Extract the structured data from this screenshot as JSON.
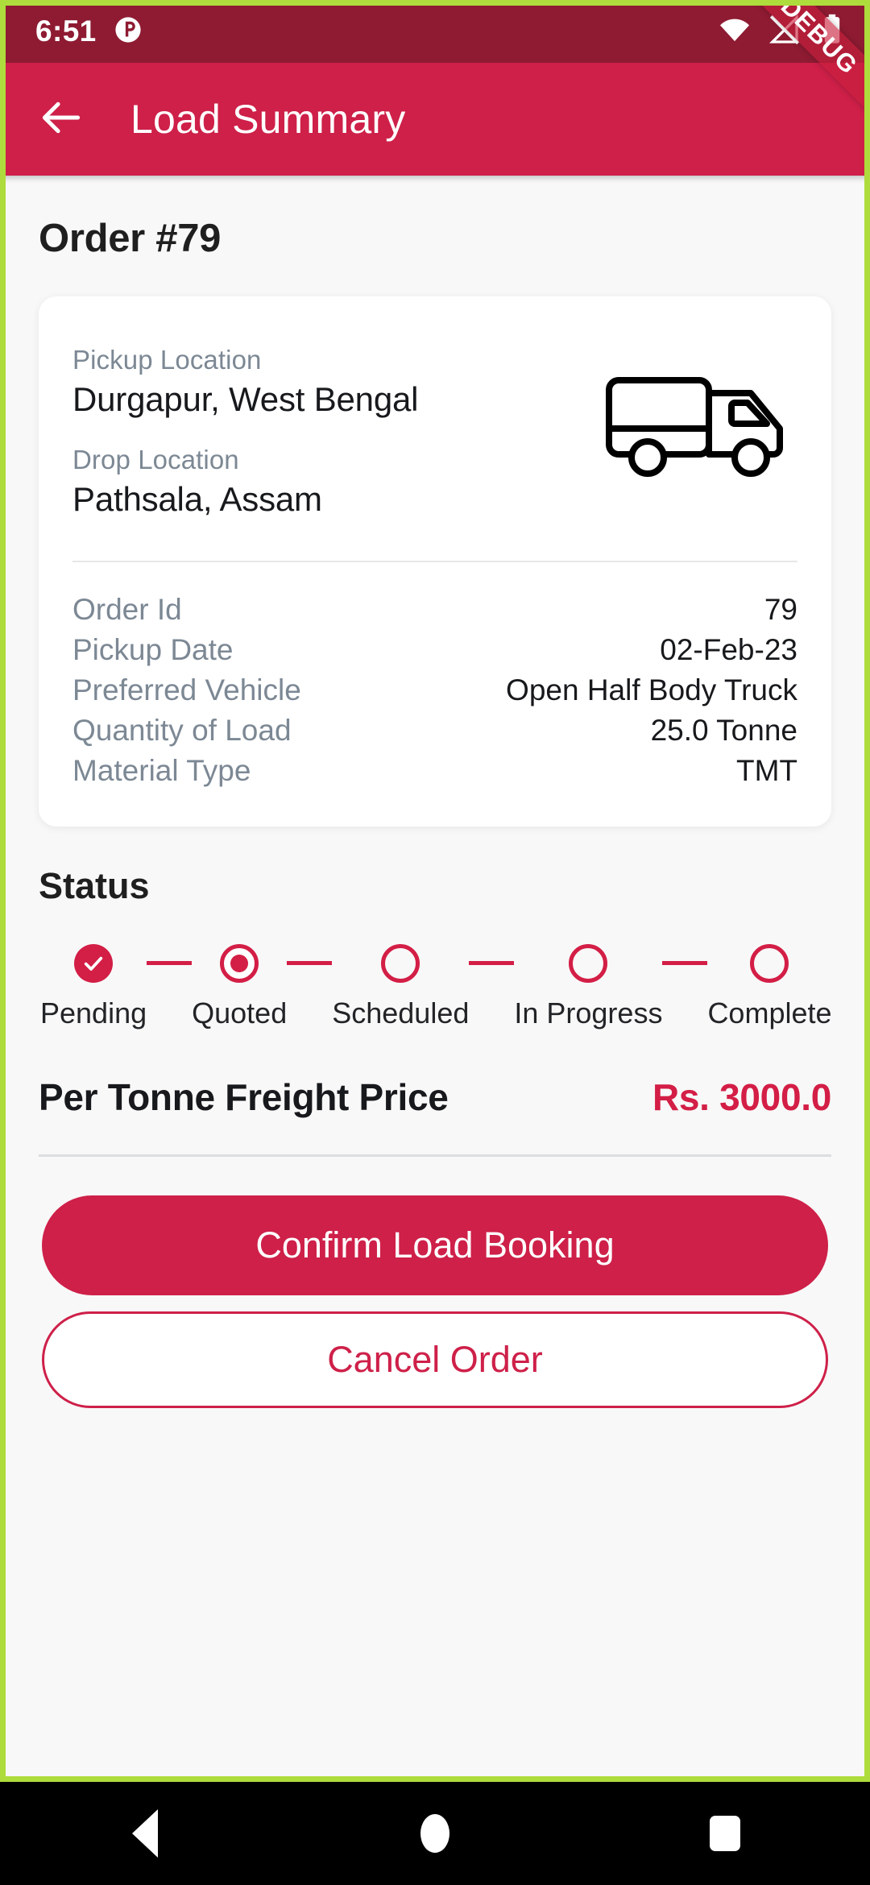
{
  "status_bar": {
    "clock": "6:51",
    "icons": [
      "circle-dot-icon",
      "wifi-icon",
      "cellular-off-icon",
      "battery-icon"
    ]
  },
  "debug_ribbon": {
    "label": "DEBUG"
  },
  "app_bar": {
    "back_icon": "arrow-left-icon",
    "title": "Load Summary"
  },
  "page": {
    "order_title": "Order #79"
  },
  "load_card": {
    "pickup_label": "Pickup Location",
    "pickup_value": "Durgapur, West Bengal",
    "drop_label": "Drop Location",
    "drop_value": "Pathsala, Assam",
    "truck_icon": "delivery-truck-icon",
    "details": [
      {
        "key": "Order Id",
        "value": "79"
      },
      {
        "key": "Pickup Date",
        "value": "02-Feb-23"
      },
      {
        "key": "Preferred Vehicle",
        "value": "Open Half Body Truck"
      },
      {
        "key": "Quantity of Load",
        "value": "25.0 Tonne"
      },
      {
        "key": "Material Type",
        "value": "TMT"
      }
    ]
  },
  "status_section": {
    "heading": "Status",
    "steps": [
      {
        "label": "Pending",
        "state": "done"
      },
      {
        "label": "Quoted",
        "state": "current"
      },
      {
        "label": "Scheduled",
        "state": "todo"
      },
      {
        "label": "In Progress",
        "state": "todo"
      },
      {
        "label": "Complete",
        "state": "todo"
      }
    ]
  },
  "price": {
    "label": "Per Tonne Freight Price",
    "value": "Rs. 3000.0"
  },
  "actions": {
    "confirm_label": "Confirm Load Booking",
    "cancel_label": "Cancel Order"
  },
  "nav_bar": {
    "back": "nav-back-icon",
    "home": "nav-home-icon",
    "recents": "nav-recents-icon"
  },
  "colors": {
    "status_bar": "#8E1B32",
    "app_bar": "#CE2049",
    "accent": "#D31E46",
    "debug_border": "#AEDC3C",
    "page_bg": "#F8F8F8",
    "card_bg": "#FFFFFF",
    "muted_text": "#7C8894",
    "primary_text": "#17191C"
  }
}
